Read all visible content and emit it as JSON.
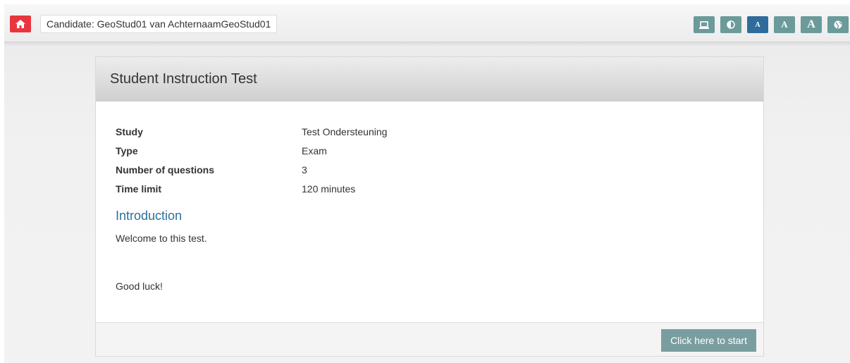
{
  "header": {
    "candidate_label": "Candidate: GeoStud01 van AchternaamGeoStud01",
    "home_icon": "home-icon",
    "tools": [
      {
        "name": "monitor-icon",
        "glyph": ""
      },
      {
        "name": "contrast-icon",
        "glyph": ""
      },
      {
        "name": "font-small-icon",
        "glyph": "A"
      },
      {
        "name": "font-medium-icon",
        "glyph": "A"
      },
      {
        "name": "font-large-icon",
        "glyph": "A"
      },
      {
        "name": "globe-icon",
        "glyph": ""
      }
    ]
  },
  "card": {
    "title": "Student Instruction Test",
    "info": [
      {
        "label": "Study",
        "value": "Test Ondersteuning"
      },
      {
        "label": "Type",
        "value": "Exam"
      },
      {
        "label": "Number of questions",
        "value": "3"
      },
      {
        "label": "Time limit",
        "value": "120 minutes"
      }
    ],
    "intro_heading": "Introduction",
    "welcome_text": "Welcome to this test.",
    "closing_text": "Good luck!",
    "start_button": "Click here to start"
  },
  "colors": {
    "home_red": "#e8363f",
    "tool_teal": "#6b9a9a",
    "tool_active_blue": "#2f6c9b",
    "heading_blue": "#2b6f9a",
    "start_button": "#7a9ea0"
  }
}
